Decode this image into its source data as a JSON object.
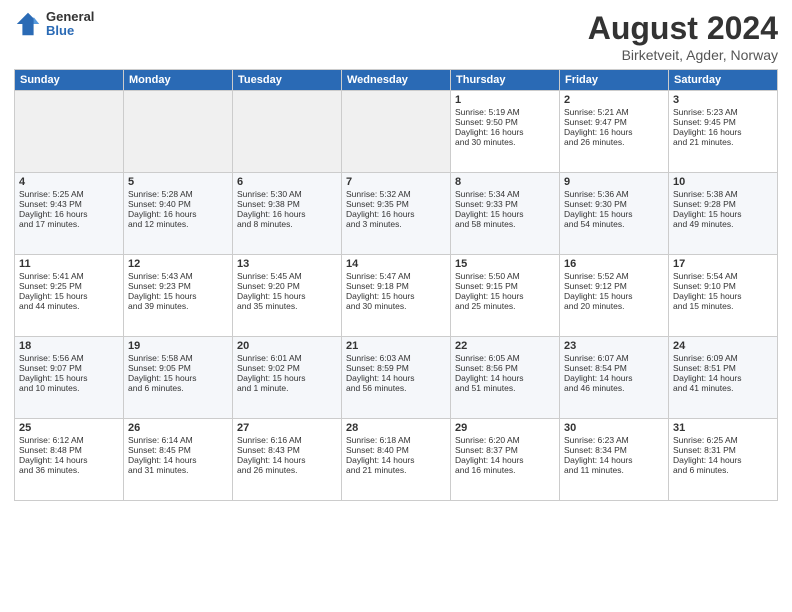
{
  "logo": {
    "general": "General",
    "blue": "Blue"
  },
  "title": "August 2024",
  "subtitle": "Birketveit, Agder, Norway",
  "headers": [
    "Sunday",
    "Monday",
    "Tuesday",
    "Wednesday",
    "Thursday",
    "Friday",
    "Saturday"
  ],
  "rows": [
    [
      {
        "day": "",
        "content": ""
      },
      {
        "day": "",
        "content": ""
      },
      {
        "day": "",
        "content": ""
      },
      {
        "day": "",
        "content": ""
      },
      {
        "day": "1",
        "content": "Sunrise: 5:19 AM\nSunset: 9:50 PM\nDaylight: 16 hours\nand 30 minutes."
      },
      {
        "day": "2",
        "content": "Sunrise: 5:21 AM\nSunset: 9:47 PM\nDaylight: 16 hours\nand 26 minutes."
      },
      {
        "day": "3",
        "content": "Sunrise: 5:23 AM\nSunset: 9:45 PM\nDaylight: 16 hours\nand 21 minutes."
      }
    ],
    [
      {
        "day": "4",
        "content": "Sunrise: 5:25 AM\nSunset: 9:43 PM\nDaylight: 16 hours\nand 17 minutes."
      },
      {
        "day": "5",
        "content": "Sunrise: 5:28 AM\nSunset: 9:40 PM\nDaylight: 16 hours\nand 12 minutes."
      },
      {
        "day": "6",
        "content": "Sunrise: 5:30 AM\nSunset: 9:38 PM\nDaylight: 16 hours\nand 8 minutes."
      },
      {
        "day": "7",
        "content": "Sunrise: 5:32 AM\nSunset: 9:35 PM\nDaylight: 16 hours\nand 3 minutes."
      },
      {
        "day": "8",
        "content": "Sunrise: 5:34 AM\nSunset: 9:33 PM\nDaylight: 15 hours\nand 58 minutes."
      },
      {
        "day": "9",
        "content": "Sunrise: 5:36 AM\nSunset: 9:30 PM\nDaylight: 15 hours\nand 54 minutes."
      },
      {
        "day": "10",
        "content": "Sunrise: 5:38 AM\nSunset: 9:28 PM\nDaylight: 15 hours\nand 49 minutes."
      }
    ],
    [
      {
        "day": "11",
        "content": "Sunrise: 5:41 AM\nSunset: 9:25 PM\nDaylight: 15 hours\nand 44 minutes."
      },
      {
        "day": "12",
        "content": "Sunrise: 5:43 AM\nSunset: 9:23 PM\nDaylight: 15 hours\nand 39 minutes."
      },
      {
        "day": "13",
        "content": "Sunrise: 5:45 AM\nSunset: 9:20 PM\nDaylight: 15 hours\nand 35 minutes."
      },
      {
        "day": "14",
        "content": "Sunrise: 5:47 AM\nSunset: 9:18 PM\nDaylight: 15 hours\nand 30 minutes."
      },
      {
        "day": "15",
        "content": "Sunrise: 5:50 AM\nSunset: 9:15 PM\nDaylight: 15 hours\nand 25 minutes."
      },
      {
        "day": "16",
        "content": "Sunrise: 5:52 AM\nSunset: 9:12 PM\nDaylight: 15 hours\nand 20 minutes."
      },
      {
        "day": "17",
        "content": "Sunrise: 5:54 AM\nSunset: 9:10 PM\nDaylight: 15 hours\nand 15 minutes."
      }
    ],
    [
      {
        "day": "18",
        "content": "Sunrise: 5:56 AM\nSunset: 9:07 PM\nDaylight: 15 hours\nand 10 minutes."
      },
      {
        "day": "19",
        "content": "Sunrise: 5:58 AM\nSunset: 9:05 PM\nDaylight: 15 hours\nand 6 minutes."
      },
      {
        "day": "20",
        "content": "Sunrise: 6:01 AM\nSunset: 9:02 PM\nDaylight: 15 hours\nand 1 minute."
      },
      {
        "day": "21",
        "content": "Sunrise: 6:03 AM\nSunset: 8:59 PM\nDaylight: 14 hours\nand 56 minutes."
      },
      {
        "day": "22",
        "content": "Sunrise: 6:05 AM\nSunset: 8:56 PM\nDaylight: 14 hours\nand 51 minutes."
      },
      {
        "day": "23",
        "content": "Sunrise: 6:07 AM\nSunset: 8:54 PM\nDaylight: 14 hours\nand 46 minutes."
      },
      {
        "day": "24",
        "content": "Sunrise: 6:09 AM\nSunset: 8:51 PM\nDaylight: 14 hours\nand 41 minutes."
      }
    ],
    [
      {
        "day": "25",
        "content": "Sunrise: 6:12 AM\nSunset: 8:48 PM\nDaylight: 14 hours\nand 36 minutes."
      },
      {
        "day": "26",
        "content": "Sunrise: 6:14 AM\nSunset: 8:45 PM\nDaylight: 14 hours\nand 31 minutes."
      },
      {
        "day": "27",
        "content": "Sunrise: 6:16 AM\nSunset: 8:43 PM\nDaylight: 14 hours\nand 26 minutes."
      },
      {
        "day": "28",
        "content": "Sunrise: 6:18 AM\nSunset: 8:40 PM\nDaylight: 14 hours\nand 21 minutes."
      },
      {
        "day": "29",
        "content": "Sunrise: 6:20 AM\nSunset: 8:37 PM\nDaylight: 14 hours\nand 16 minutes."
      },
      {
        "day": "30",
        "content": "Sunrise: 6:23 AM\nSunset: 8:34 PM\nDaylight: 14 hours\nand 11 minutes."
      },
      {
        "day": "31",
        "content": "Sunrise: 6:25 AM\nSunset: 8:31 PM\nDaylight: 14 hours\nand 6 minutes."
      }
    ]
  ]
}
